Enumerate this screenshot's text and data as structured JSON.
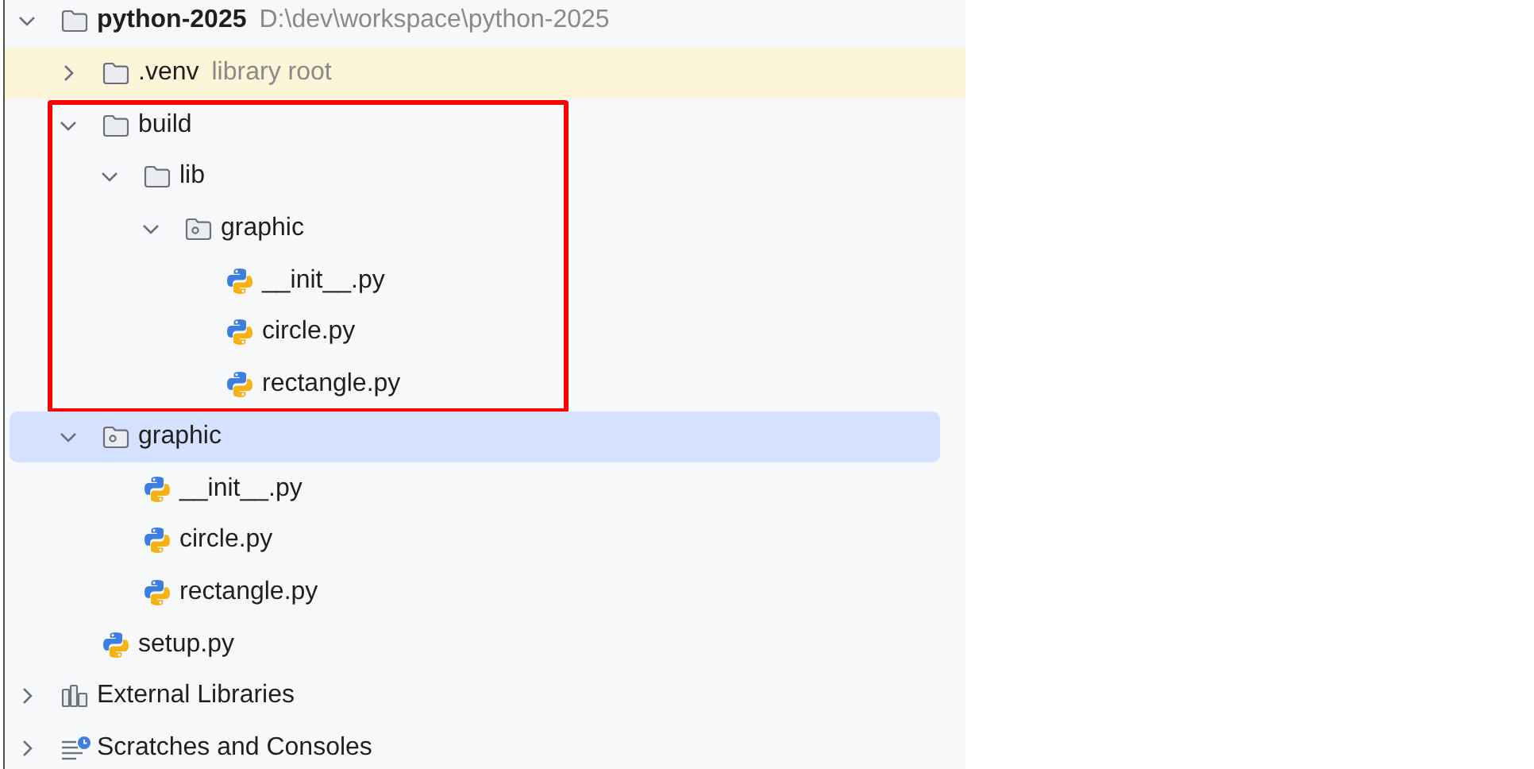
{
  "tree": [
    {
      "kind": "project",
      "label": "python-2025",
      "hint": "D:\\dev\\workspace\\python-2025",
      "expanded": true,
      "selected": false,
      "highlighted": false,
      "boxed": false,
      "children": [
        {
          "kind": "folder",
          "label": ".venv",
          "hint": "library root",
          "expanded": false,
          "selected": false,
          "highlighted": true,
          "boxed": false
        },
        {
          "kind": "folder",
          "label": "build",
          "expanded": true,
          "selected": false,
          "highlighted": false,
          "boxed": true,
          "children": [
            {
              "kind": "folder",
              "label": "lib",
              "expanded": true,
              "selected": false,
              "highlighted": false,
              "boxed": false,
              "children": [
                {
                  "kind": "package",
                  "label": "graphic",
                  "expanded": true,
                  "selected": false,
                  "highlighted": false,
                  "boxed": false,
                  "children": [
                    {
                      "kind": "python",
                      "label": "__init__.py",
                      "selected": false,
                      "highlighted": false,
                      "boxed": false
                    },
                    {
                      "kind": "python",
                      "label": "circle.py",
                      "selected": false,
                      "highlighted": false,
                      "boxed": false
                    },
                    {
                      "kind": "python",
                      "label": "rectangle.py",
                      "selected": false,
                      "highlighted": false,
                      "boxed": false
                    }
                  ]
                }
              ]
            }
          ]
        },
        {
          "kind": "package",
          "label": "graphic",
          "expanded": true,
          "selected": true,
          "highlighted": false,
          "boxed": false,
          "children": [
            {
              "kind": "python",
              "label": "__init__.py",
              "selected": false,
              "highlighted": false,
              "boxed": false
            },
            {
              "kind": "python",
              "label": "circle.py",
              "selected": false,
              "highlighted": false,
              "boxed": false
            },
            {
              "kind": "python",
              "label": "rectangle.py",
              "selected": false,
              "highlighted": false,
              "boxed": false
            }
          ]
        },
        {
          "kind": "python",
          "label": "setup.py",
          "selected": false,
          "highlighted": false,
          "boxed": false
        }
      ]
    },
    {
      "kind": "libraries",
      "label": "External Libraries",
      "expanded": false,
      "selected": false,
      "highlighted": false,
      "boxed": false
    },
    {
      "kind": "scratches",
      "label": "Scratches and Consoles",
      "expanded": false,
      "selected": false,
      "highlighted": false,
      "boxed": false
    }
  ]
}
